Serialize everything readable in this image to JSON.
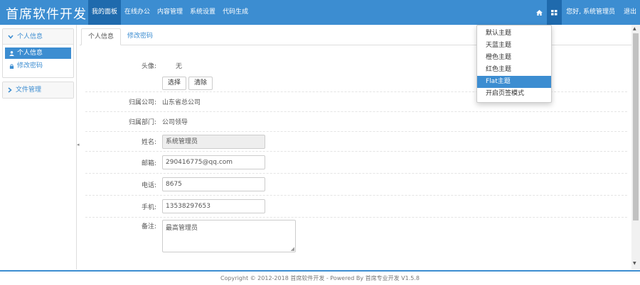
{
  "brand": "首席软件开发",
  "topnav": [
    "我的面板",
    "在线办公",
    "内容管理",
    "系统设置",
    "代码生成"
  ],
  "topright": {
    "home_icon": "home-icon",
    "theme_icon": "grid-icon",
    "greeting": "您好, 系统管理员",
    "logout": "退出"
  },
  "theme_menu": [
    "默认主题",
    "天蓝主题",
    "橙色主题",
    "红色主题",
    "Flat主题",
    "开启页签模式"
  ],
  "sidebar": {
    "panel1": {
      "title": "个人信息",
      "items": [
        "个人信息",
        "修改密码"
      ]
    },
    "panel2": {
      "title": "文件管理"
    }
  },
  "tabs": [
    "个人信息",
    "修改密码"
  ],
  "form": {
    "avatar_label": "头像:",
    "avatar_value": "无",
    "select_btn": "选择",
    "clear_btn": "清除",
    "company_label": "归属公司:",
    "company_value": "山东省总公司",
    "dept_label": "归属部门:",
    "dept_value": "公司领导",
    "name_label": "姓名:",
    "name_value": "系统管理员",
    "email_label": "邮箱:",
    "email_value": "290416775@qq.com",
    "phone_label": "电话:",
    "phone_value": "8675",
    "mobile_label": "手机:",
    "mobile_value": "13538297653",
    "remarks_label": "备注:",
    "remarks_value": "最高管理员"
  },
  "footer": "Copyright © 2012-2018 首席软件开发 - Powered By 首席专业开发 V1.5.8",
  "colors": {
    "primary": "#3c8dd1",
    "primary_dark": "#1f6aad"
  }
}
